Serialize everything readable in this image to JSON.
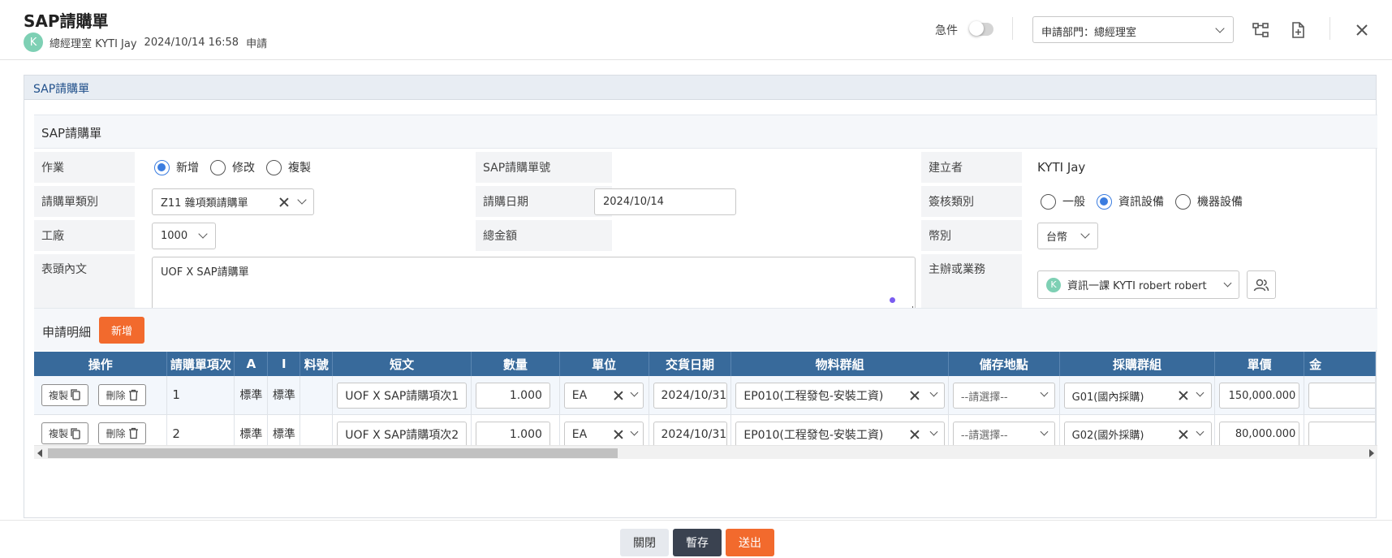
{
  "header": {
    "title": "SAP請購單",
    "avatar_letter": "K",
    "user_dept": "總經理室 KYTI Jay",
    "datetime": "2024/10/14 16:58",
    "action": "申請",
    "urgent_label": "急件",
    "urgent_on": false,
    "dept_select": "申請部門：總經理室"
  },
  "panel": {
    "title": "SAP請購單",
    "section_title": "SAP請購單",
    "fields": {
      "operation_label": "作業",
      "operation_options": [
        "新增",
        "修改",
        "複製"
      ],
      "operation_selected": "新增",
      "sap_no_label": "SAP請購單號",
      "sap_no_value": "",
      "creator_label": "建立者",
      "creator_value": "KYTI Jay",
      "type_label": "請購單類別",
      "type_value": "Z11 雜項類請購單",
      "date_label": "請購日期",
      "date_value": "2024/10/14",
      "approval_label": "簽核類別",
      "approval_options": [
        "一般",
        "資訊設備",
        "機器設備"
      ],
      "approval_selected": "資訊設備",
      "plant_label": "工廠",
      "plant_value": "1000",
      "total_label": "總金額",
      "total_value": "",
      "currency_label": "幣別",
      "currency_value": "台幣",
      "header_text_label": "表頭內文",
      "header_text_value": "UOF X SAP請購單",
      "owner_label": "主辦或業務",
      "owner_avatar": "K",
      "owner_value": "資訊一課 KYTI robert  robert"
    },
    "detail_title": "申請明細",
    "add_button": "新增",
    "columns": [
      "操作",
      "請購單項次",
      "A",
      "I",
      "料號",
      "短文",
      "數量",
      "單位",
      "交貨日期",
      "物料群組",
      "儲存地點",
      "採購群組",
      "單價",
      "金"
    ],
    "rows": [
      {
        "copy": "複製",
        "delete": "刪除",
        "item": "1",
        "a": "標準",
        "i": "標準",
        "material": "",
        "short_text": "UOF X SAP請購項次1",
        "qty": "1.000",
        "unit": "EA",
        "delivery": "2024/10/31",
        "mat_group": "EP010(工程發包-安裝工資)",
        "storage": "--請選擇--",
        "purch_group": "G01(國內採購)",
        "price": "150,000.000"
      },
      {
        "copy": "複製",
        "delete": "刪除",
        "item": "2",
        "a": "標準",
        "i": "標準",
        "material": "",
        "short_text": "UOF X SAP請購項次2",
        "qty": "1.000",
        "unit": "EA",
        "delivery": "2024/10/31",
        "mat_group": "EP010(工程發包-安裝工資)",
        "storage": "--請選擇--",
        "purch_group": "G02(國外採購)",
        "price": "80,000.000"
      }
    ]
  },
  "footer": {
    "close": "關閉",
    "save": "暫存",
    "submit": "送出"
  },
  "colors": {
    "accent_orange": "#f26a2d",
    "table_header": "#386a9b",
    "radio_blue": "#3b7de0",
    "save_dark": "#3a4250"
  }
}
